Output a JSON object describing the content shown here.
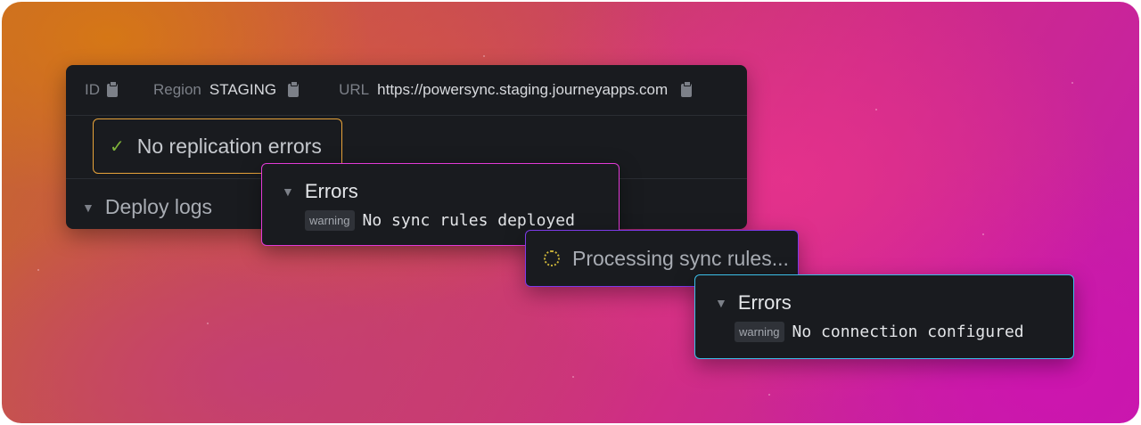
{
  "instance": {
    "id_label": "ID",
    "region_label": "Region",
    "region_value": "STAGING",
    "url_label": "URL",
    "url_value": "https://powersync.staging.journeyapps.com"
  },
  "replication": {
    "status_text": "No replication errors",
    "status_icon": "check-icon",
    "status_color": "#7fb33a",
    "border_color": "#e8a33a"
  },
  "deploy_logs": {
    "label": "Deploy logs"
  },
  "sync_rules_errors": {
    "title": "Errors",
    "badge": "warning",
    "message": "No sync rules deployed",
    "border_color": "#e23ad6"
  },
  "processing": {
    "text": "Processing sync rules...",
    "border_color": "#7c3ae8"
  },
  "connection_errors": {
    "title": "Errors",
    "badge": "warning",
    "message": "No connection configured",
    "border_color": "#3cbfe8"
  }
}
